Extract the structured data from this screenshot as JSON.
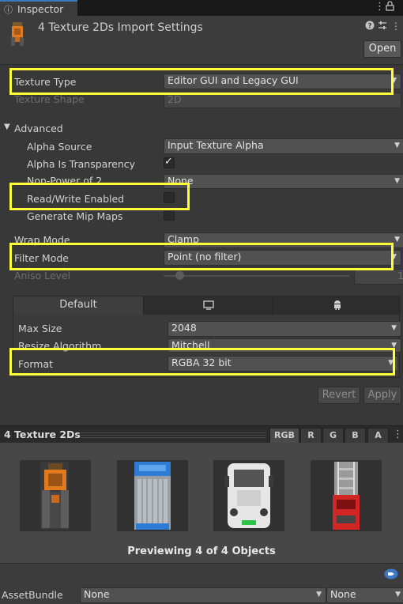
{
  "tab": {
    "label": "Inspector"
  },
  "header": {
    "title": "4 Texture 2Ds Import Settings",
    "open_label": "Open"
  },
  "texture_type": {
    "label": "Texture Type",
    "value": "Editor GUI and Legacy GUI"
  },
  "texture_shape": {
    "label": "Texture Shape",
    "value": "2D"
  },
  "advanced": {
    "label": "Advanced",
    "alpha_source": {
      "label": "Alpha Source",
      "value": "Input Texture Alpha"
    },
    "alpha_is_transparency": {
      "label": "Alpha Is Transparency",
      "checked": true
    },
    "non_power_of_2": {
      "label": "Non-Power of 2",
      "value": "None"
    },
    "read_write": {
      "label": "Read/Write Enabled",
      "checked": false
    },
    "generate_mips": {
      "label": "Generate Mip Maps",
      "checked": false
    }
  },
  "wrap_mode": {
    "label": "Wrap Mode",
    "value": "Clamp"
  },
  "filter_mode": {
    "label": "Filter Mode",
    "value": "Point (no filter)"
  },
  "aniso_level": {
    "label": "Aniso Level",
    "value": "1"
  },
  "platform_tabs": {
    "default_label": "Default"
  },
  "platform_settings": {
    "max_size": {
      "label": "Max Size",
      "value": "2048"
    },
    "resize_algorithm": {
      "label": "Resize Algorithm",
      "value": "Mitchell"
    },
    "format": {
      "label": "Format",
      "value": "RGBA 32 bit"
    }
  },
  "actions": {
    "revert_label": "Revert",
    "apply_label": "Apply"
  },
  "preview": {
    "title": "4 Texture 2Ds",
    "channels": [
      "RGB",
      "R",
      "G",
      "B",
      "A"
    ],
    "caption": "Previewing 4 of 4 Objects"
  },
  "asset_bundle": {
    "label": "AssetBundle",
    "name_value": "None",
    "variant_value": "None"
  },
  "colors": {
    "highlight": "#ffff3a",
    "tab_accent": "#3a79bb"
  }
}
